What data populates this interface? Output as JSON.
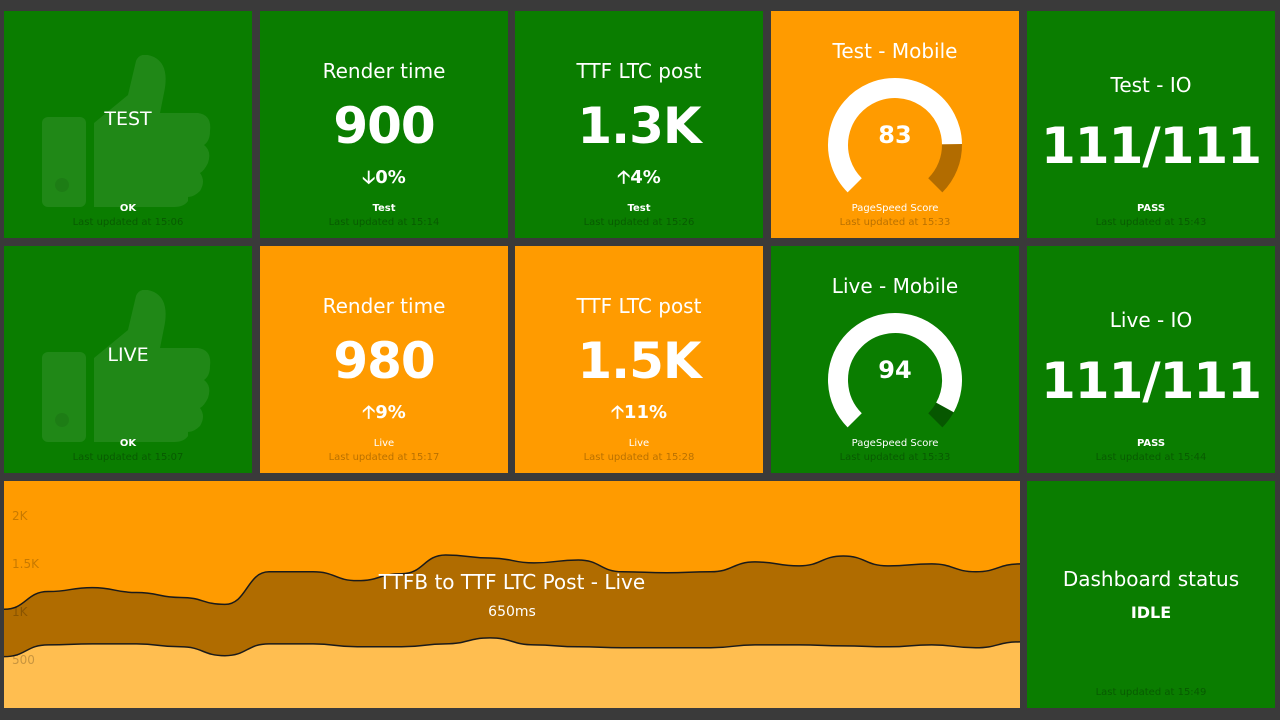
{
  "row1": {
    "test_status": {
      "word": "TEST",
      "info": "OK",
      "updated": "Last updated at 15:06"
    },
    "render": {
      "title": "Render time",
      "value": "900",
      "arrow": "down",
      "change": "0%",
      "info": "Test",
      "updated": "Last updated at 15:14"
    },
    "ttf": {
      "title": "TTF LTC post",
      "value": "1.3K",
      "arrow": "up",
      "change": "4%",
      "info": "Test",
      "updated": "Last updated at 15:26"
    },
    "mobile": {
      "title": "Test - Mobile",
      "value": "83",
      "fraction": 0.83,
      "info": "PageSpeed Score",
      "updated": "Last updated at 15:33"
    },
    "io": {
      "title": "Test - IO",
      "value": "111/111",
      "info": "PASS",
      "updated": "Last updated at 15:43"
    }
  },
  "row2": {
    "live_status": {
      "word": "LIVE",
      "info": "OK",
      "updated": "Last updated at 15:07"
    },
    "render": {
      "title": "Render time",
      "value": "980",
      "arrow": "up",
      "change": "9%",
      "info": "Live",
      "updated": "Last updated at 15:17"
    },
    "ttf": {
      "title": "TTF LTC post",
      "value": "1.5K",
      "arrow": "up",
      "change": "11%",
      "info": "Live",
      "updated": "Last updated at 15:28"
    },
    "mobile": {
      "title": "Live - Mobile",
      "value": "94",
      "fraction": 0.94,
      "info": "PageSpeed Score",
      "updated": "Last updated at 15:33"
    },
    "io": {
      "title": "Live - IO",
      "value": "111/111",
      "info": "PASS",
      "updated": "Last updated at 15:44"
    }
  },
  "chart": {
    "title": "TTFB to TTF LTC Post - Live",
    "value": "650ms",
    "y_ticks": [
      "500",
      "1K",
      "1.5K",
      "2K"
    ]
  },
  "dashboard": {
    "title": "Dashboard status",
    "state": "IDLE",
    "updated": "Last updated at 15:49"
  },
  "colors": {
    "ok": "#0a7d00",
    "warn": "#ff9b00",
    "background": "#3a3a3a"
  },
  "chart_data": {
    "type": "area",
    "series": [
      {
        "values": [
          520,
          640,
          650,
          650,
          620,
          530,
          650,
          650,
          620,
          620,
          650,
          710,
          640,
          620,
          610,
          610,
          610,
          640,
          640,
          630,
          620,
          640,
          610,
          670
        ]
      },
      {
        "values": [
          1000,
          1180,
          1220,
          1170,
          1120,
          1050,
          1380,
          1380,
          1290,
          1360,
          1550,
          1520,
          1470,
          1500,
          1380,
          1370,
          1380,
          1480,
          1440,
          1540,
          1440,
          1460,
          1380,
          1460
        ]
      }
    ],
    "ylim": [
      0,
      2300
    ]
  }
}
